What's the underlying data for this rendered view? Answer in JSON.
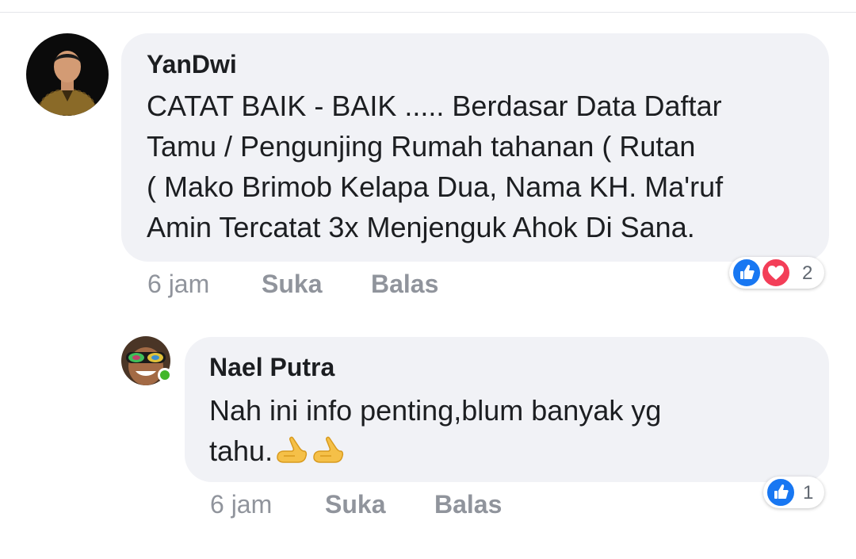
{
  "comments": [
    {
      "author": "YanDwi",
      "lines": [
        "CATAT BAIK - BAIK ..... Berdasar Data Daftar",
        "Tamu / Pengunjing Rumah tahanan ( Rutan",
        "( Mako Brimob Kelapa Dua, Nama KH. Ma'ruf",
        "Amin Tercatat 3x Menjenguk Ahok Di Sana."
      ],
      "time": "6 jam",
      "like_label": "Suka",
      "reply_label": "Balas",
      "reactions": [
        "like-icon",
        "love-icon"
      ],
      "reaction_count": "2"
    },
    {
      "author": "Nael Putra",
      "lines": [
        "Nah ini info penting,blum banyak yg",
        "tahu."
      ],
      "emoji": [
        "thumbs-up-icon",
        "thumbs-up-icon"
      ],
      "time": "6 jam",
      "like_label": "Suka",
      "reply_label": "Balas",
      "reactions": [
        "like-icon"
      ],
      "reaction_count": "1",
      "online": true
    }
  ],
  "colors": {
    "bubble": "#f1f2f6",
    "meta_text": "#90949c",
    "like_blue": "#1877f2",
    "love_red": "#f33e58",
    "online_green": "#42b72a"
  }
}
